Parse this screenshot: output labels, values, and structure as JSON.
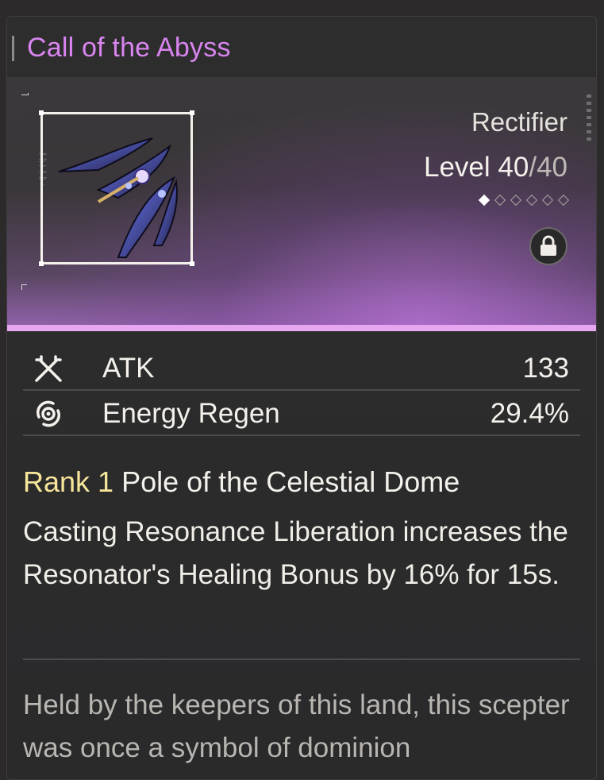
{
  "weapon": {
    "name": "Call of the Abyss",
    "type": "Rectifier",
    "level_label": "Level",
    "level_current": "40",
    "level_separator": "/",
    "level_max": "40",
    "rank_stars_total": 6,
    "rank_stars_filled": 1,
    "locked": true
  },
  "stats": [
    {
      "icon": "atk-crossed-swords-icon",
      "name": "ATK",
      "value": "133"
    },
    {
      "icon": "energy-regen-icon",
      "name": "Energy Regen",
      "value": "29.4%"
    }
  ],
  "passive": {
    "rank_label": "Rank 1",
    "title": "Pole of the Celestial Dome",
    "description": "Casting Resonance Liberation increases the Resonator's Healing Bonus by 16% for 15s."
  },
  "lore": "Held by the keepers of this land, this scepter was once a symbol of dominion",
  "colors": {
    "title": "#d985f0",
    "rank": "#f6e69a",
    "accent_line": "#e7a6f0"
  }
}
